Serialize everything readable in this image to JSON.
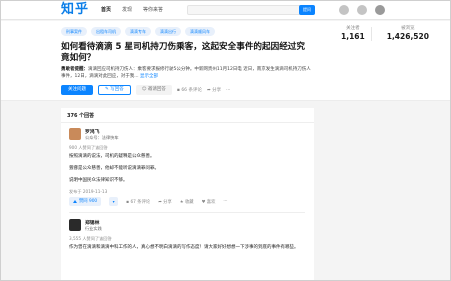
{
  "brand": {
    "logo": "知乎"
  },
  "nav": {
    "items": [
      "首页",
      "发现",
      "等你来答"
    ]
  },
  "search": {
    "button": "提问"
  },
  "question": {
    "tags": [
      "刑事案件",
      "出租车司机",
      "滴滴专车",
      "滴滴出行",
      "滴滴顺风车"
    ],
    "title": "如何看待滴滴 5 星司机持刀伤乘客，这起安全事件的起因经过究竟如何？",
    "desc_prefix": "勇敢者提醒：",
    "desc": "滴滴回应司机持刀伤人：乘客要求报修行驶5公分钟。中新网贵州11月12日电 近日，南京发生滴滴司机持刀伤人事件，12日，滴滴对此回应，对于我...",
    "desc_more": "显示全部",
    "actions": {
      "follow": "关注问题",
      "write": "写回答",
      "invite": "邀请回答",
      "comments": "66 条评论",
      "share": "分享",
      "more": "···"
    }
  },
  "stats": [
    {
      "label": "关注者",
      "value": "1,161"
    },
    {
      "label": "被浏览",
      "value": "1,426,520"
    }
  ],
  "answers": {
    "count_label": "376 个回答",
    "items": [
      {
        "author": "罗鸿飞",
        "bio": "公众号：法律快车",
        "endorse": "900 人赞同了该回答",
        "paragraphs": [
          "按照滴滴的说法，司机的疑释是公众慈善。",
          "聋聋是公众慈善，他却不能听说滴滴罪问罪。",
          "说明中国民众法律知识不够。"
        ],
        "date": "发布于 2019-11-13",
        "vote": "赞同 900",
        "comments": "67 条评论",
        "share": "分享",
        "favorite": "收藏",
        "like": "喜欢",
        "more": "···"
      },
      {
        "author": "郑锡林",
        "bio": "行业实践",
        "endorse": "3,555 人赞同了该回答",
        "paragraphs": [
          "作为曾在滴滴和滴滴中科工作的人，真心想不明白滴滴的写作态度！请大家好好想想一下涉事的到底的事件有哪些。"
        ]
      }
    ]
  },
  "colors": {
    "accent": "#0b84ff",
    "brand": "#0b7ee8"
  }
}
